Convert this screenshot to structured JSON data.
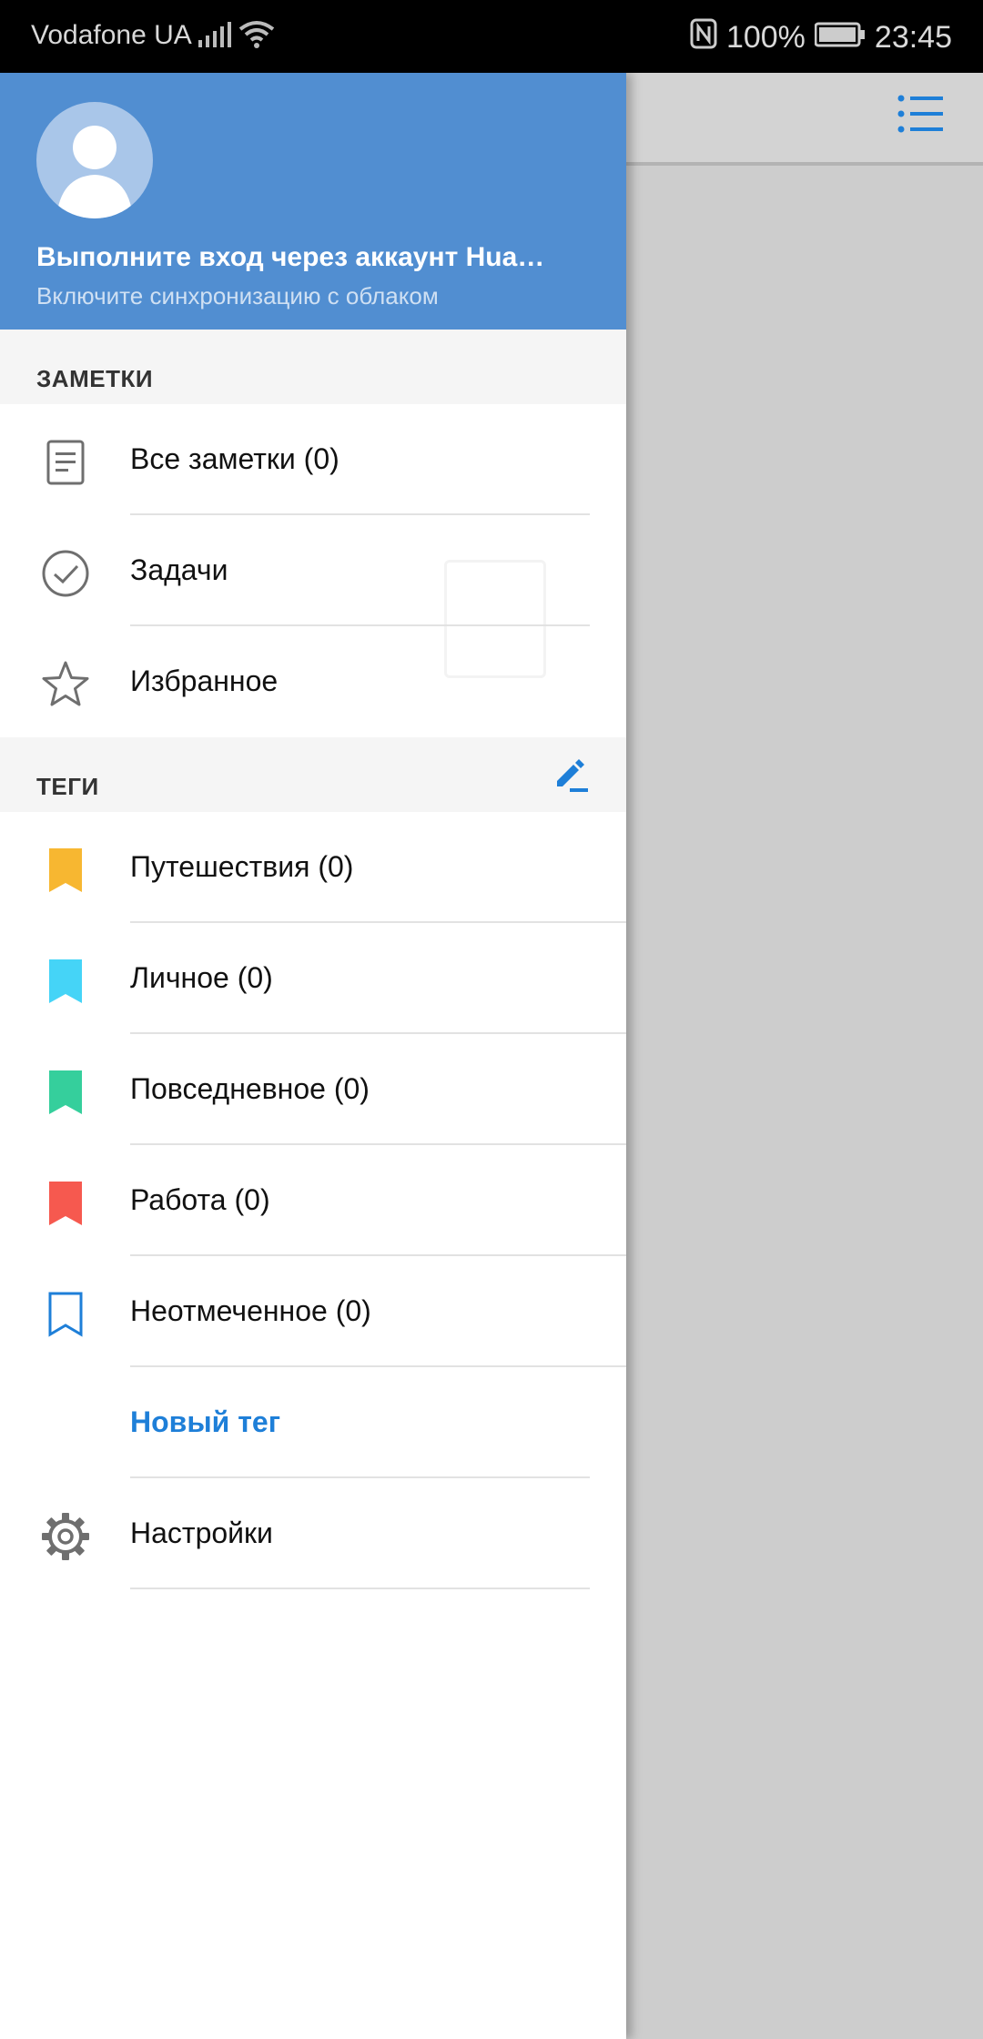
{
  "status_bar": {
    "carrier": "Vodafone UA",
    "battery": "100%",
    "time": "23:45"
  },
  "drawer": {
    "login_title": "Выполните вход через аккаунт Hua…",
    "login_subtitle": "Включите синхронизацию с облаком",
    "notes_section": "ЗАМЕТКИ",
    "notes_items": [
      {
        "label": "Все заметки (0)",
        "icon": "document-icon"
      },
      {
        "label": "Задачи",
        "icon": "check-circle-icon"
      },
      {
        "label": "Избранное",
        "icon": "star-icon"
      }
    ],
    "tags_section": "ТЕГИ",
    "tags": [
      {
        "label": "Путешествия (0)",
        "color": "#f7b731"
      },
      {
        "label": "Личное (0)",
        "color": "#45d4f7"
      },
      {
        "label": "Повседневное (0)",
        "color": "#35cf9c"
      },
      {
        "label": "Работа (0)",
        "color": "#f6594f"
      },
      {
        "label": "Неотмеченное (0)",
        "color": "#1e7fd8"
      }
    ],
    "new_tag": "Новый тег",
    "settings": "Настройки"
  }
}
